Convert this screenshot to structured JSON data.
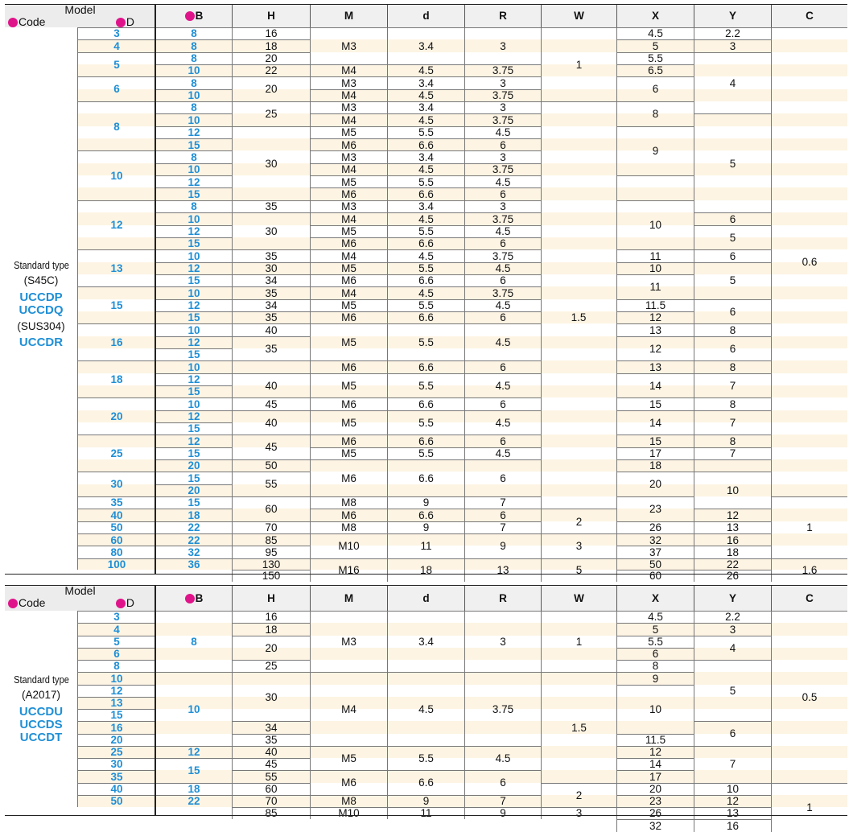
{
  "headers": {
    "model": "Model",
    "code": "Code",
    "d_col": "D",
    "b_col": "B",
    "cols": [
      "H",
      "M",
      "d",
      "R",
      "W",
      "X",
      "Y",
      "C"
    ],
    "markers": [
      "1",
      "2",
      "3"
    ]
  },
  "table1": {
    "std_label": "Standard type",
    "material1": "(S45C)",
    "names1": [
      "UCCDP",
      "UCCDQ"
    ],
    "material2": "(SUS304)",
    "names2": [
      "UCCDR"
    ],
    "D": [
      [
        "3",
        0,
        1
      ],
      [
        "4",
        1,
        1
      ],
      [
        "5",
        2,
        2
      ],
      [
        "6",
        4,
        2
      ],
      [
        "8",
        6,
        4
      ],
      [
        "10",
        10,
        4
      ],
      [
        "12",
        14,
        4
      ],
      [
        "13",
        18,
        3
      ],
      [
        "15",
        21,
        3
      ],
      [
        "16",
        24,
        3
      ],
      [
        "18",
        27,
        3
      ],
      [
        "20",
        30,
        3
      ],
      [
        "25",
        33,
        3
      ],
      [
        "30",
        36,
        2
      ],
      [
        "35",
        38,
        1
      ],
      [
        "40",
        39,
        1
      ],
      [
        "50",
        40,
        1
      ],
      [
        "60",
        41,
        1
      ],
      [
        "80",
        42,
        1
      ],
      [
        "100",
        43,
        1
      ]
    ],
    "B": [
      [
        "8",
        0,
        1
      ],
      [
        "8",
        1,
        1
      ],
      [
        "8",
        2,
        1
      ],
      [
        "10",
        3,
        1
      ],
      [
        "8",
        4,
        1
      ],
      [
        "10",
        5,
        1
      ],
      [
        "8",
        6,
        1
      ],
      [
        "10",
        7,
        1
      ],
      [
        "12",
        8,
        1
      ],
      [
        "15",
        9,
        1
      ],
      [
        "8",
        10,
        1
      ],
      [
        "10",
        11,
        1
      ],
      [
        "12",
        12,
        1
      ],
      [
        "15",
        13,
        1
      ],
      [
        "8",
        14,
        1
      ],
      [
        "10",
        15,
        1
      ],
      [
        "12",
        16,
        1
      ],
      [
        "15",
        17,
        1
      ],
      [
        "10",
        18,
        1
      ],
      [
        "12",
        19,
        1
      ],
      [
        "15",
        20,
        1
      ],
      [
        "10",
        21,
        1
      ],
      [
        "12",
        22,
        1
      ],
      [
        "15",
        23,
        1
      ],
      [
        "10",
        24,
        1
      ],
      [
        "12",
        25,
        1
      ],
      [
        "15",
        26,
        1
      ],
      [
        "10",
        27,
        1
      ],
      [
        "12",
        28,
        1
      ],
      [
        "15",
        29,
        1
      ],
      [
        "10",
        30,
        1
      ],
      [
        "12",
        31,
        1
      ],
      [
        "15",
        32,
        1
      ],
      [
        "12",
        33,
        1
      ],
      [
        "15",
        34,
        1
      ],
      [
        "20",
        35,
        1
      ],
      [
        "15",
        36,
        1
      ],
      [
        "20",
        37,
        1
      ],
      [
        "15",
        38,
        1
      ],
      [
        "18",
        39,
        1
      ],
      [
        "22",
        40,
        1
      ],
      [
        "22",
        41,
        1
      ],
      [
        "32",
        42,
        1
      ],
      [
        "36",
        43,
        1
      ]
    ],
    "H": [
      [
        "16",
        0,
        1
      ],
      [
        "18",
        1,
        1
      ],
      [
        "20",
        2,
        1
      ],
      [
        "22",
        3,
        1
      ],
      [
        "20",
        4,
        2
      ],
      [
        "25",
        6,
        2
      ],
      [
        "30",
        8,
        6
      ],
      [
        "35",
        14,
        1
      ],
      [
        "30",
        15,
        3
      ],
      [
        "35",
        18,
        1
      ],
      [
        "30",
        19,
        1
      ],
      [
        "34",
        20,
        1
      ],
      [
        "35",
        21,
        1
      ],
      [
        "34",
        22,
        1
      ],
      [
        "35",
        23,
        1
      ],
      [
        "40",
        24,
        1
      ],
      [
        "35",
        25,
        2
      ],
      [
        "",
        27,
        1
      ],
      [
        "40",
        28,
        2
      ],
      [
        "45",
        30,
        1
      ],
      [
        "40",
        31,
        2
      ],
      [
        "45",
        33,
        2
      ],
      [
        "50",
        35,
        1
      ],
      [
        "55",
        36,
        2
      ],
      [
        "60",
        38,
        2
      ],
      [
        "70",
        40,
        1
      ],
      [
        "85",
        41,
        1
      ],
      [
        "95",
        42,
        1
      ],
      [
        "130",
        43,
        1
      ],
      [
        "150",
        44,
        1
      ]
    ],
    "M": [
      [
        "M3",
        0,
        3
      ],
      [
        "M4",
        3,
        1
      ],
      [
        "M3",
        4,
        1
      ],
      [
        "M4",
        5,
        1
      ],
      [
        "M3",
        6,
        1
      ],
      [
        "M4",
        7,
        1
      ],
      [
        "M5",
        8,
        1
      ],
      [
        "M6",
        9,
        1
      ],
      [
        "M3",
        10,
        1
      ],
      [
        "M4",
        11,
        1
      ],
      [
        "M5",
        12,
        1
      ],
      [
        "M6",
        13,
        1
      ],
      [
        "M3",
        14,
        1
      ],
      [
        "M4",
        15,
        1
      ],
      [
        "M5",
        16,
        1
      ],
      [
        "M6",
        17,
        1
      ],
      [
        "M4",
        18,
        1
      ],
      [
        "M5",
        19,
        1
      ],
      [
        "M6",
        20,
        1
      ],
      [
        "M4",
        21,
        1
      ],
      [
        "M5",
        22,
        1
      ],
      [
        "M6",
        23,
        1
      ],
      [
        "M5",
        24,
        3
      ],
      [
        "M6",
        27,
        1
      ],
      [
        "M5",
        28,
        2
      ],
      [
        "M6",
        30,
        1
      ],
      [
        "M5",
        31,
        2
      ],
      [
        "M6",
        33,
        1
      ],
      [
        "M5",
        34,
        1
      ],
      [
        "M6",
        35,
        3
      ],
      [
        "M8",
        38,
        1
      ],
      [
        "M6",
        39,
        1
      ],
      [
        "M8",
        40,
        1
      ],
      [
        "M10",
        41,
        2
      ],
      [
        "M16",
        43,
        2
      ]
    ],
    "dd": [
      [
        "3.4",
        0,
        3
      ],
      [
        "4.5",
        3,
        1
      ],
      [
        "3.4",
        4,
        1
      ],
      [
        "4.5",
        5,
        1
      ],
      [
        "3.4",
        6,
        1
      ],
      [
        "4.5",
        7,
        1
      ],
      [
        "5.5",
        8,
        1
      ],
      [
        "6.6",
        9,
        1
      ],
      [
        "3.4",
        10,
        1
      ],
      [
        "4.5",
        11,
        1
      ],
      [
        "5.5",
        12,
        1
      ],
      [
        "6.6",
        13,
        1
      ],
      [
        "3.4",
        14,
        1
      ],
      [
        "4.5",
        15,
        1
      ],
      [
        "5.5",
        16,
        1
      ],
      [
        "6.6",
        17,
        1
      ],
      [
        "4.5",
        18,
        1
      ],
      [
        "5.5",
        19,
        1
      ],
      [
        "6.6",
        20,
        1
      ],
      [
        "4.5",
        21,
        1
      ],
      [
        "5.5",
        22,
        1
      ],
      [
        "6.6",
        23,
        1
      ],
      [
        "5.5",
        24,
        3
      ],
      [
        "6.6",
        27,
        1
      ],
      [
        "5.5",
        28,
        2
      ],
      [
        "6.6",
        30,
        1
      ],
      [
        "5.5",
        31,
        2
      ],
      [
        "6.6",
        33,
        1
      ],
      [
        "5.5",
        34,
        1
      ],
      [
        "6.6",
        35,
        3
      ],
      [
        "9",
        38,
        1
      ],
      [
        "6.6",
        39,
        1
      ],
      [
        "9",
        40,
        1
      ],
      [
        "11",
        41,
        2
      ],
      [
        "18",
        43,
        2
      ]
    ],
    "R": [
      [
        "3",
        0,
        3
      ],
      [
        "3.75",
        3,
        1
      ],
      [
        "3",
        4,
        1
      ],
      [
        "3.75",
        5,
        1
      ],
      [
        "3",
        6,
        1
      ],
      [
        "3.75",
        7,
        1
      ],
      [
        "4.5",
        8,
        1
      ],
      [
        "6",
        9,
        1
      ],
      [
        "3",
        10,
        1
      ],
      [
        "3.75",
        11,
        1
      ],
      [
        "4.5",
        12,
        1
      ],
      [
        "6",
        13,
        1
      ],
      [
        "3",
        14,
        1
      ],
      [
        "3.75",
        15,
        1
      ],
      [
        "4.5",
        16,
        1
      ],
      [
        "6",
        17,
        1
      ],
      [
        "3.75",
        18,
        1
      ],
      [
        "4.5",
        19,
        1
      ],
      [
        "6",
        20,
        1
      ],
      [
        "3.75",
        21,
        1
      ],
      [
        "4.5",
        22,
        1
      ],
      [
        "6",
        23,
        1
      ],
      [
        "4.5",
        24,
        3
      ],
      [
        "6",
        27,
        1
      ],
      [
        "4.5",
        28,
        2
      ],
      [
        "6",
        30,
        1
      ],
      [
        "4.5",
        31,
        2
      ],
      [
        "6",
        33,
        1
      ],
      [
        "4.5",
        34,
        1
      ],
      [
        "6",
        35,
        3
      ],
      [
        "7",
        38,
        1
      ],
      [
        "6",
        39,
        1
      ],
      [
        "7",
        40,
        1
      ],
      [
        "9",
        41,
        2
      ],
      [
        "13",
        43,
        2
      ]
    ],
    "W": [
      [
        "1",
        0,
        6
      ],
      [
        "",
        6,
        33
      ],
      [
        "2",
        39,
        2
      ],
      [
        "3",
        41,
        2
      ],
      [
        "5",
        43,
        2
      ]
    ],
    "W15": "1.5",
    "X": [
      [
        "4.5",
        0,
        1
      ],
      [
        "5",
        1,
        1
      ],
      [
        "5.5",
        2,
        1
      ],
      [
        "6.5",
        3,
        1
      ],
      [
        "6",
        4,
        2
      ],
      [
        "8",
        6,
        2
      ],
      [
        "9",
        8,
        4
      ],
      [
        "",
        12,
        2
      ],
      [
        "10",
        14,
        4
      ],
      [
        "11",
        18,
        1
      ],
      [
        "10",
        19,
        1
      ],
      [
        "11",
        20,
        2
      ],
      [
        "11.5",
        22,
        1
      ],
      [
        "12",
        23,
        1
      ],
      [
        "13",
        24,
        1
      ],
      [
        "12",
        25,
        2
      ],
      [
        "13",
        27,
        1
      ],
      [
        "14",
        28,
        2
      ],
      [
        "15",
        30,
        1
      ],
      [
        "14",
        31,
        2
      ],
      [
        "15",
        33,
        1
      ],
      [
        "17",
        34,
        1
      ],
      [
        "18",
        35,
        1
      ],
      [
        "20",
        36,
        2
      ],
      [
        "23",
        38,
        2
      ],
      [
        "26",
        40,
        1
      ],
      [
        "32",
        41,
        1
      ],
      [
        "37",
        42,
        1
      ],
      [
        "50",
        43,
        1
      ],
      [
        "60",
        44,
        1
      ]
    ],
    "Y": [
      [
        "2.2",
        0,
        1
      ],
      [
        "3",
        1,
        1
      ],
      [
        "4",
        2,
        5
      ],
      [
        "5",
        7,
        8
      ],
      [
        "6",
        15,
        1
      ],
      [
        "5",
        16,
        2
      ],
      [
        "6",
        18,
        1
      ],
      [
        "5",
        19,
        3
      ],
      [
        "6",
        22,
        2
      ],
      [
        "8",
        24,
        1
      ],
      [
        "6",
        25,
        2
      ],
      [
        "8",
        27,
        1
      ],
      [
        "7",
        28,
        2
      ],
      [
        "8",
        30,
        1
      ],
      [
        "7",
        31,
        2
      ],
      [
        "8",
        33,
        1
      ],
      [
        "7",
        34,
        1
      ],
      [
        "",
        35,
        1
      ],
      [
        "10",
        36,
        3
      ],
      [
        "12",
        39,
        1
      ],
      [
        "13",
        40,
        1
      ],
      [
        "16",
        41,
        1
      ],
      [
        "18",
        42,
        1
      ],
      [
        "22",
        43,
        1
      ],
      [
        "26",
        44,
        1
      ]
    ],
    "C": [
      [
        "0.6",
        0,
        38
      ],
      [
        "1",
        38,
        5
      ],
      [
        "1.6",
        43,
        2
      ]
    ]
  },
  "table2": {
    "std_label": "Standard type",
    "material1": "(A2017)",
    "names1": [
      "UCCDU",
      "UCCDS",
      "UCCDT"
    ],
    "D": [
      "3",
      "4",
      "5",
      "6",
      "8",
      "10",
      "12",
      "13",
      "15",
      "16",
      "20",
      "25",
      "30",
      "35",
      "40",
      "50"
    ],
    "B": [
      [
        "8",
        0,
        5
      ],
      [
        "10",
        5,
        6
      ],
      [
        "12",
        11,
        1
      ],
      [
        "15",
        12,
        2
      ],
      [
        "18",
        14,
        1
      ],
      [
        "22",
        15,
        1
      ]
    ],
    "H": [
      [
        "16",
        0,
        1
      ],
      [
        "18",
        1,
        1
      ],
      [
        "20",
        2,
        2
      ],
      [
        "25",
        4,
        1
      ],
      [
        "30",
        5,
        4
      ],
      [
        "34",
        9,
        1
      ],
      [
        "35",
        10,
        1
      ],
      [
        "40",
        11,
        1
      ],
      [
        "45",
        12,
        1
      ],
      [
        "55",
        13,
        1
      ],
      [
        "60",
        14,
        1
      ],
      [
        "70",
        15,
        1
      ],
      [
        "85",
        16,
        1
      ]
    ],
    "M": [
      [
        "M3",
        0,
        5
      ],
      [
        "M4",
        5,
        6
      ],
      [
        "M5",
        11,
        2
      ],
      [
        "M6",
        13,
        2
      ],
      [
        "M8",
        15,
        1
      ],
      [
        "M10",
        16,
        1
      ]
    ],
    "dd": [
      [
        "3.4",
        0,
        5
      ],
      [
        "4.5",
        5,
        6
      ],
      [
        "5.5",
        11,
        2
      ],
      [
        "6.6",
        13,
        2
      ],
      [
        "9",
        15,
        1
      ],
      [
        "11",
        16,
        1
      ]
    ],
    "R": [
      [
        "3",
        0,
        5
      ],
      [
        "3.75",
        5,
        6
      ],
      [
        "4.5",
        11,
        2
      ],
      [
        "6",
        13,
        2
      ],
      [
        "7",
        15,
        1
      ],
      [
        "9",
        16,
        1
      ]
    ],
    "W": [
      [
        "1",
        0,
        5
      ],
      [
        "1.5",
        5,
        9
      ],
      [
        "2",
        14,
        2
      ],
      [
        "3",
        16,
        1
      ]
    ],
    "X": [
      [
        "4.5",
        0,
        1
      ],
      [
        "5",
        1,
        1
      ],
      [
        "5.5",
        2,
        1
      ],
      [
        "6",
        3,
        1
      ],
      [
        "8",
        4,
        1
      ],
      [
        "9",
        5,
        1
      ],
      [
        "10",
        6,
        4
      ],
      [
        "11.5",
        10,
        1
      ],
      [
        "12",
        11,
        1
      ],
      [
        "14",
        12,
        1
      ],
      [
        "17",
        13,
        1
      ],
      [
        "20",
        14,
        1
      ],
      [
        "23",
        15,
        1
      ],
      [
        "26",
        16,
        1
      ],
      [
        "32",
        17,
        1
      ]
    ],
    "Y": [
      [
        "2.2",
        0,
        1
      ],
      [
        "3",
        1,
        1
      ],
      [
        "4",
        2,
        2
      ],
      [
        "5",
        4,
        5
      ],
      [
        "6",
        9,
        2
      ],
      [
        "7",
        11,
        3
      ],
      [
        "10",
        14,
        1
      ],
      [
        "12",
        15,
        1
      ],
      [
        "13",
        16,
        1
      ],
      [
        "16",
        17,
        1
      ]
    ],
    "C": [
      [
        "0.5",
        0,
        14
      ],
      [
        "1",
        14,
        4
      ]
    ]
  }
}
